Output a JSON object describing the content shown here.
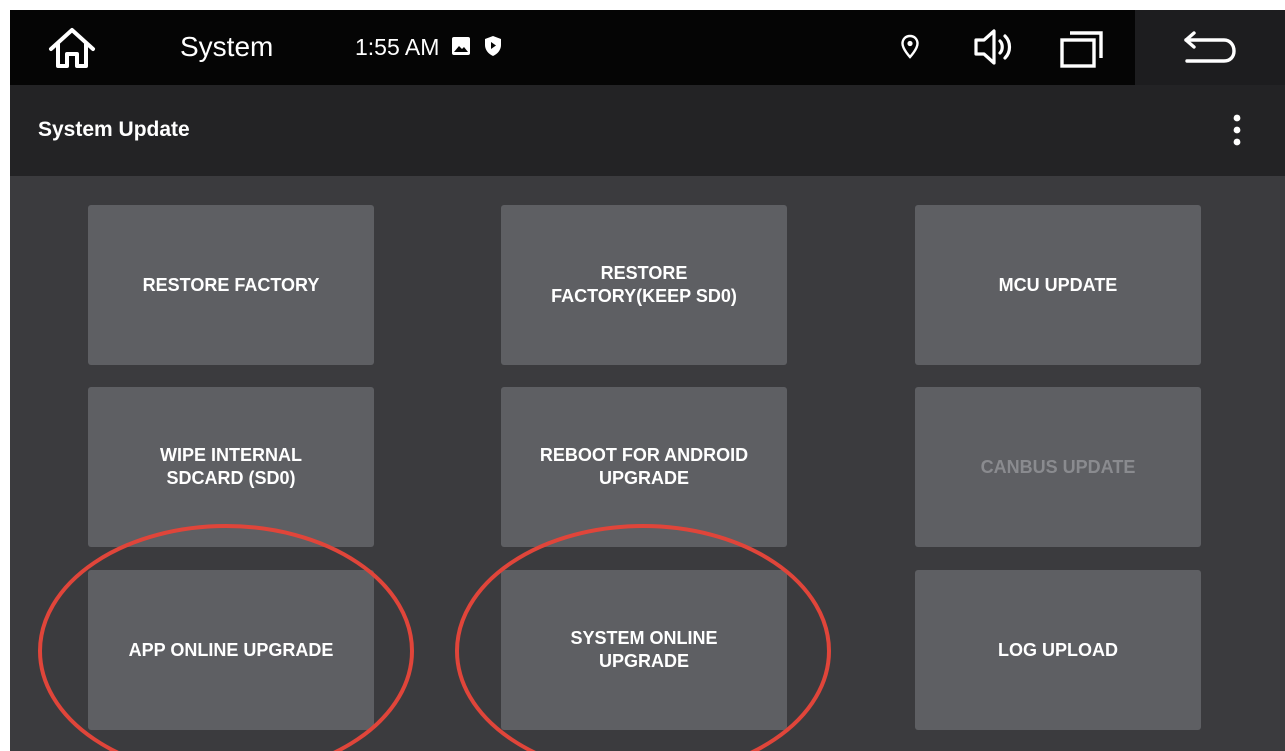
{
  "status_bar": {
    "app_name": "System",
    "time": "1:55 AM"
  },
  "header": {
    "title": "System Update"
  },
  "tiles": [
    {
      "label": "RESTORE FACTORY",
      "enabled": true
    },
    {
      "label": "RESTORE\nFACTORY(KEEP SD0)",
      "enabled": true
    },
    {
      "label": "MCU UPDATE",
      "enabled": true
    },
    {
      "label": "WIPE INTERNAL\nSDCARD (SD0)",
      "enabled": true
    },
    {
      "label": "REBOOT FOR ANDROID\nUPGRADE",
      "enabled": true
    },
    {
      "label": "CANBUS UPDATE",
      "enabled": false
    },
    {
      "label": "APP ONLINE UPGRADE",
      "enabled": true
    },
    {
      "label": "SYSTEM ONLINE\nUPGRADE",
      "enabled": true
    },
    {
      "label": "LOG UPLOAD",
      "enabled": true
    }
  ],
  "icons": {
    "home": "home-icon",
    "gallery": "image-icon",
    "shield": "shield-icon",
    "location": "location-icon",
    "volume": "volume-icon",
    "recents": "recent-apps-icon",
    "back": "back-icon",
    "menu": "more-vert-icon"
  },
  "colors": {
    "background": "#3b3b3e",
    "status_bar": "#050505",
    "title_bar": "#232325",
    "tile": "#5e5f63",
    "tile_disabled_text": "#8a8b8f",
    "annotation": "#e0453a"
  }
}
